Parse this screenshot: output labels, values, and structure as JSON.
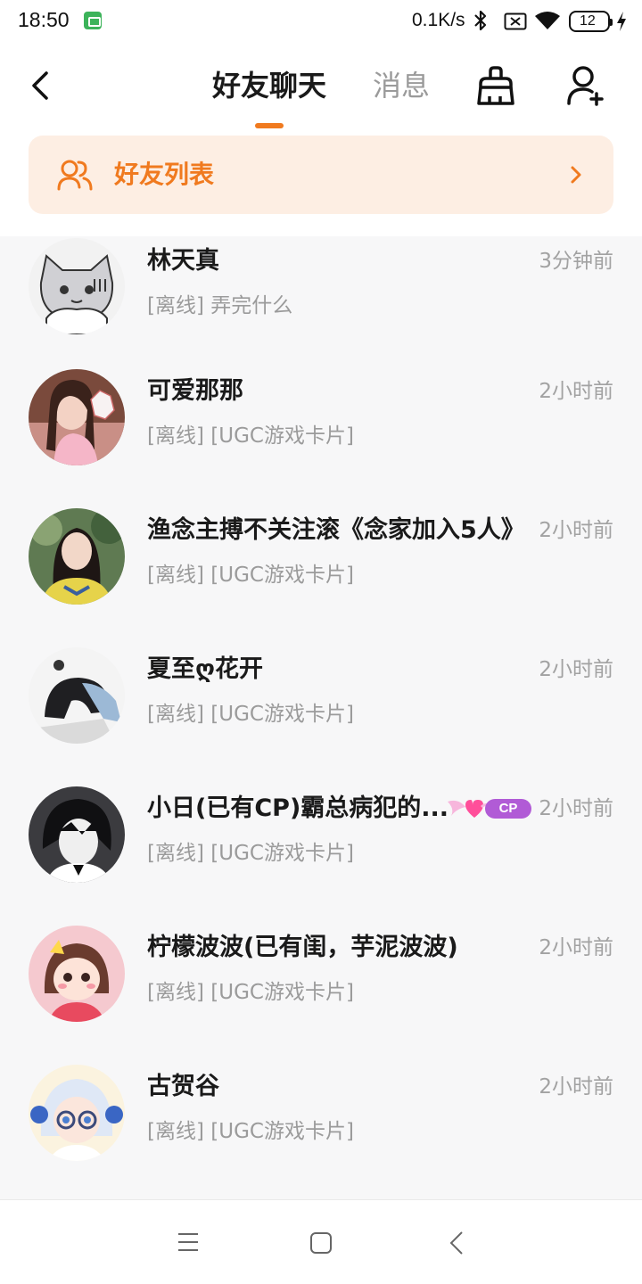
{
  "status_bar": {
    "time": "18:50",
    "net_speed": "0.1K/s",
    "battery": "12",
    "icons": [
      "app-notification-icon",
      "bluetooth-icon",
      "no-sim-icon",
      "wifi-icon",
      "battery-icon",
      "charging-icon"
    ]
  },
  "header": {
    "tabs": [
      {
        "label": "好友聊天",
        "active": true
      },
      {
        "label": "消息",
        "active": false
      }
    ],
    "accent_color": "#f07a1f",
    "actions": [
      "broom-icon",
      "add-friend-icon"
    ]
  },
  "friends_banner": {
    "label": "好友列表",
    "background": "#fdeee3"
  },
  "chats": [
    {
      "name": "林天真",
      "preview": "[离线] 弄完什么",
      "time": "3分钟前",
      "avatar": "cat-avatar"
    },
    {
      "name": "可爱那那",
      "preview": "[离线] [UGC游戏卡片]",
      "time": "2小时前",
      "avatar": "girl-pink-avatar"
    },
    {
      "name": "渔念主搏不关注滚《念家加入5人》",
      "preview": "[离线] [UGC游戏卡片]",
      "time": "2小时前",
      "avatar": "girl-outdoor-avatar"
    },
    {
      "name": "夏至ღ花开",
      "preview": "[离线] [UGC游戏卡片]",
      "time": "2小时前",
      "avatar": "anime-sketch-avatar"
    },
    {
      "name": "小日(已有CP)霸总病犯的...",
      "preview": "[离线] [UGC游戏卡片]",
      "time": "2小时前",
      "avatar": "anime-boy-avatar",
      "badge": "CP"
    },
    {
      "name": "柠檬波波(已有闺，芋泥波波)",
      "preview": "[离线] [UGC游戏卡片]",
      "time": "2小时前",
      "avatar": "chibi-girl-avatar"
    },
    {
      "name": "古贺谷",
      "preview": "[离线] [UGC游戏卡片]",
      "time": "2小时前",
      "avatar": "anime-glasses-avatar"
    }
  ],
  "navbar": {
    "buttons": [
      "menu-icon",
      "home-icon",
      "back-icon"
    ]
  }
}
